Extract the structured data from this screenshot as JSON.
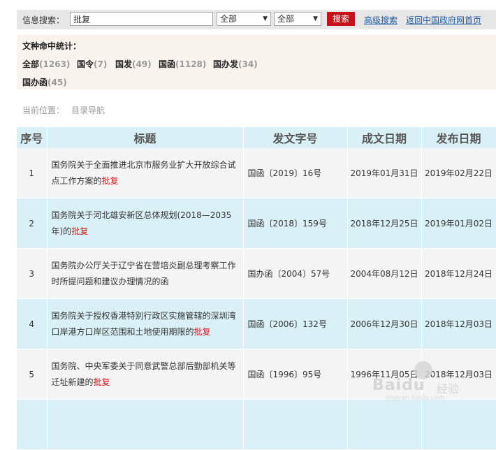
{
  "search": {
    "label": "信息搜索：",
    "keyword": "批复",
    "select1": "全部",
    "select2": "全部",
    "button": "搜索",
    "advanced": "高级搜索",
    "home": "返回中国政府网首页"
  },
  "stats": {
    "title": "文种命中统计：",
    "items": [
      {
        "label": "全部",
        "count": "(1263)"
      },
      {
        "label": "国令",
        "count": "(7)"
      },
      {
        "label": "国发",
        "count": "(49)"
      },
      {
        "label": "国函",
        "count": "(1128)"
      },
      {
        "label": "国办发",
        "count": "(34)"
      },
      {
        "label": "国办函",
        "count": "(45)"
      }
    ]
  },
  "breadcrumb": {
    "prefix": "当前位置：",
    "item": "目录导航"
  },
  "table": {
    "headers": [
      "序号",
      "标题",
      "发文字号",
      "成文日期",
      "发布日期"
    ],
    "rows": [
      {
        "no": "1",
        "title": "国务院关于全面推进北京市服务业扩大开放综合试点工作方案的",
        "hl": "批复",
        "num": "国函〔2019〕16号",
        "written": "2019年01月31日",
        "published": "2019年02月22日"
      },
      {
        "no": "2",
        "title": "国务院关于河北雄安新区总体规划(2018—2035年)的",
        "hl": "批复",
        "num": "国函〔2018〕159号",
        "written": "2018年12月25日",
        "published": "2019年01月02日"
      },
      {
        "no": "3",
        "title": "国务院办公厅关于辽宁省在营培炎副总理考察工作时所提问题和建议办理情况的函",
        "hl": "",
        "num": "国办函〔2004〕57号",
        "written": "2004年08月12日",
        "published": "2018年12月24日"
      },
      {
        "no": "4",
        "title": "国务院关于授权香港特别行政区实施管辖的深圳湾口岸港方口岸区范围和土地使用期限的",
        "hl": "批复",
        "num": "国函〔2006〕132号",
        "written": "2006年12月30日",
        "published": "2018年12月03日"
      },
      {
        "no": "5",
        "title": "国务院、中央军委关于同意武警总部后勤部机关等迁址新建的",
        "hl": "批复",
        "num": "国函〔1996〕95号",
        "written": "1996年11月05日",
        "published": "2018年12月03日"
      }
    ]
  },
  "watermark": {
    "brand": "Baidu",
    "suffix": "经验",
    "url": "jingyan.baidu.com"
  }
}
